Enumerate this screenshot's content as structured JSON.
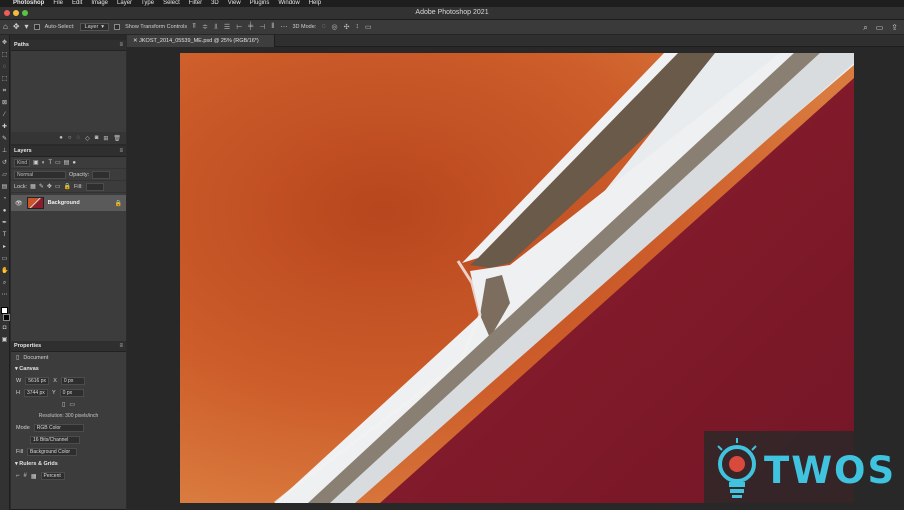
{
  "menubar": {
    "apple": "",
    "items": [
      "Photoshop",
      "File",
      "Edit",
      "Image",
      "Layer",
      "Type",
      "Select",
      "Filter",
      "3D",
      "View",
      "Plugins",
      "Window",
      "Help"
    ]
  },
  "window": {
    "title": "Adobe Photoshop 2021"
  },
  "options_bar": {
    "auto_select_label": "Auto-Select:",
    "auto_select_value": "Layer",
    "show_transform_label": "Show Transform Controls",
    "mode_3d_label": "3D Mode:"
  },
  "panels": {
    "paths": {
      "tab": "Paths"
    },
    "layers": {
      "tab": "Layers",
      "kind_placeholder": "Kind",
      "blend_mode": "Normal",
      "opacity_label": "Opacity:",
      "lock_label": "Lock:",
      "fill_label": "Fill:",
      "layer_name": "Background"
    },
    "properties": {
      "tab": "Properties",
      "doc_label": "Document",
      "canvas_section": "Canvas",
      "w_label": "W",
      "w_value": "5616 px",
      "h_label": "H",
      "h_value": "3744 px",
      "x_label": "X",
      "x_value": "0 px",
      "y_label": "Y",
      "y_value": "0 px",
      "resolution": "Resolution: 300 pixels/inch",
      "mode_label": "Mode",
      "mode_value": "RGB Color",
      "depth_value": "16 Bits/Channel",
      "fill_label": "Fill",
      "fill_value": "Background Color",
      "rulers_section": "Rulers & Grids",
      "units_value": "Percent"
    }
  },
  "document_tab": {
    "label": "JKOST_2014_05539_ME.psd @ 25% (RGB/16*)"
  },
  "watermark": {
    "text": "TWOS"
  },
  "colors": {
    "orange_water": "#c35226",
    "red_water": "#8c1c2c",
    "salt": "#e6e6e6",
    "brand": "#3fc3df"
  }
}
